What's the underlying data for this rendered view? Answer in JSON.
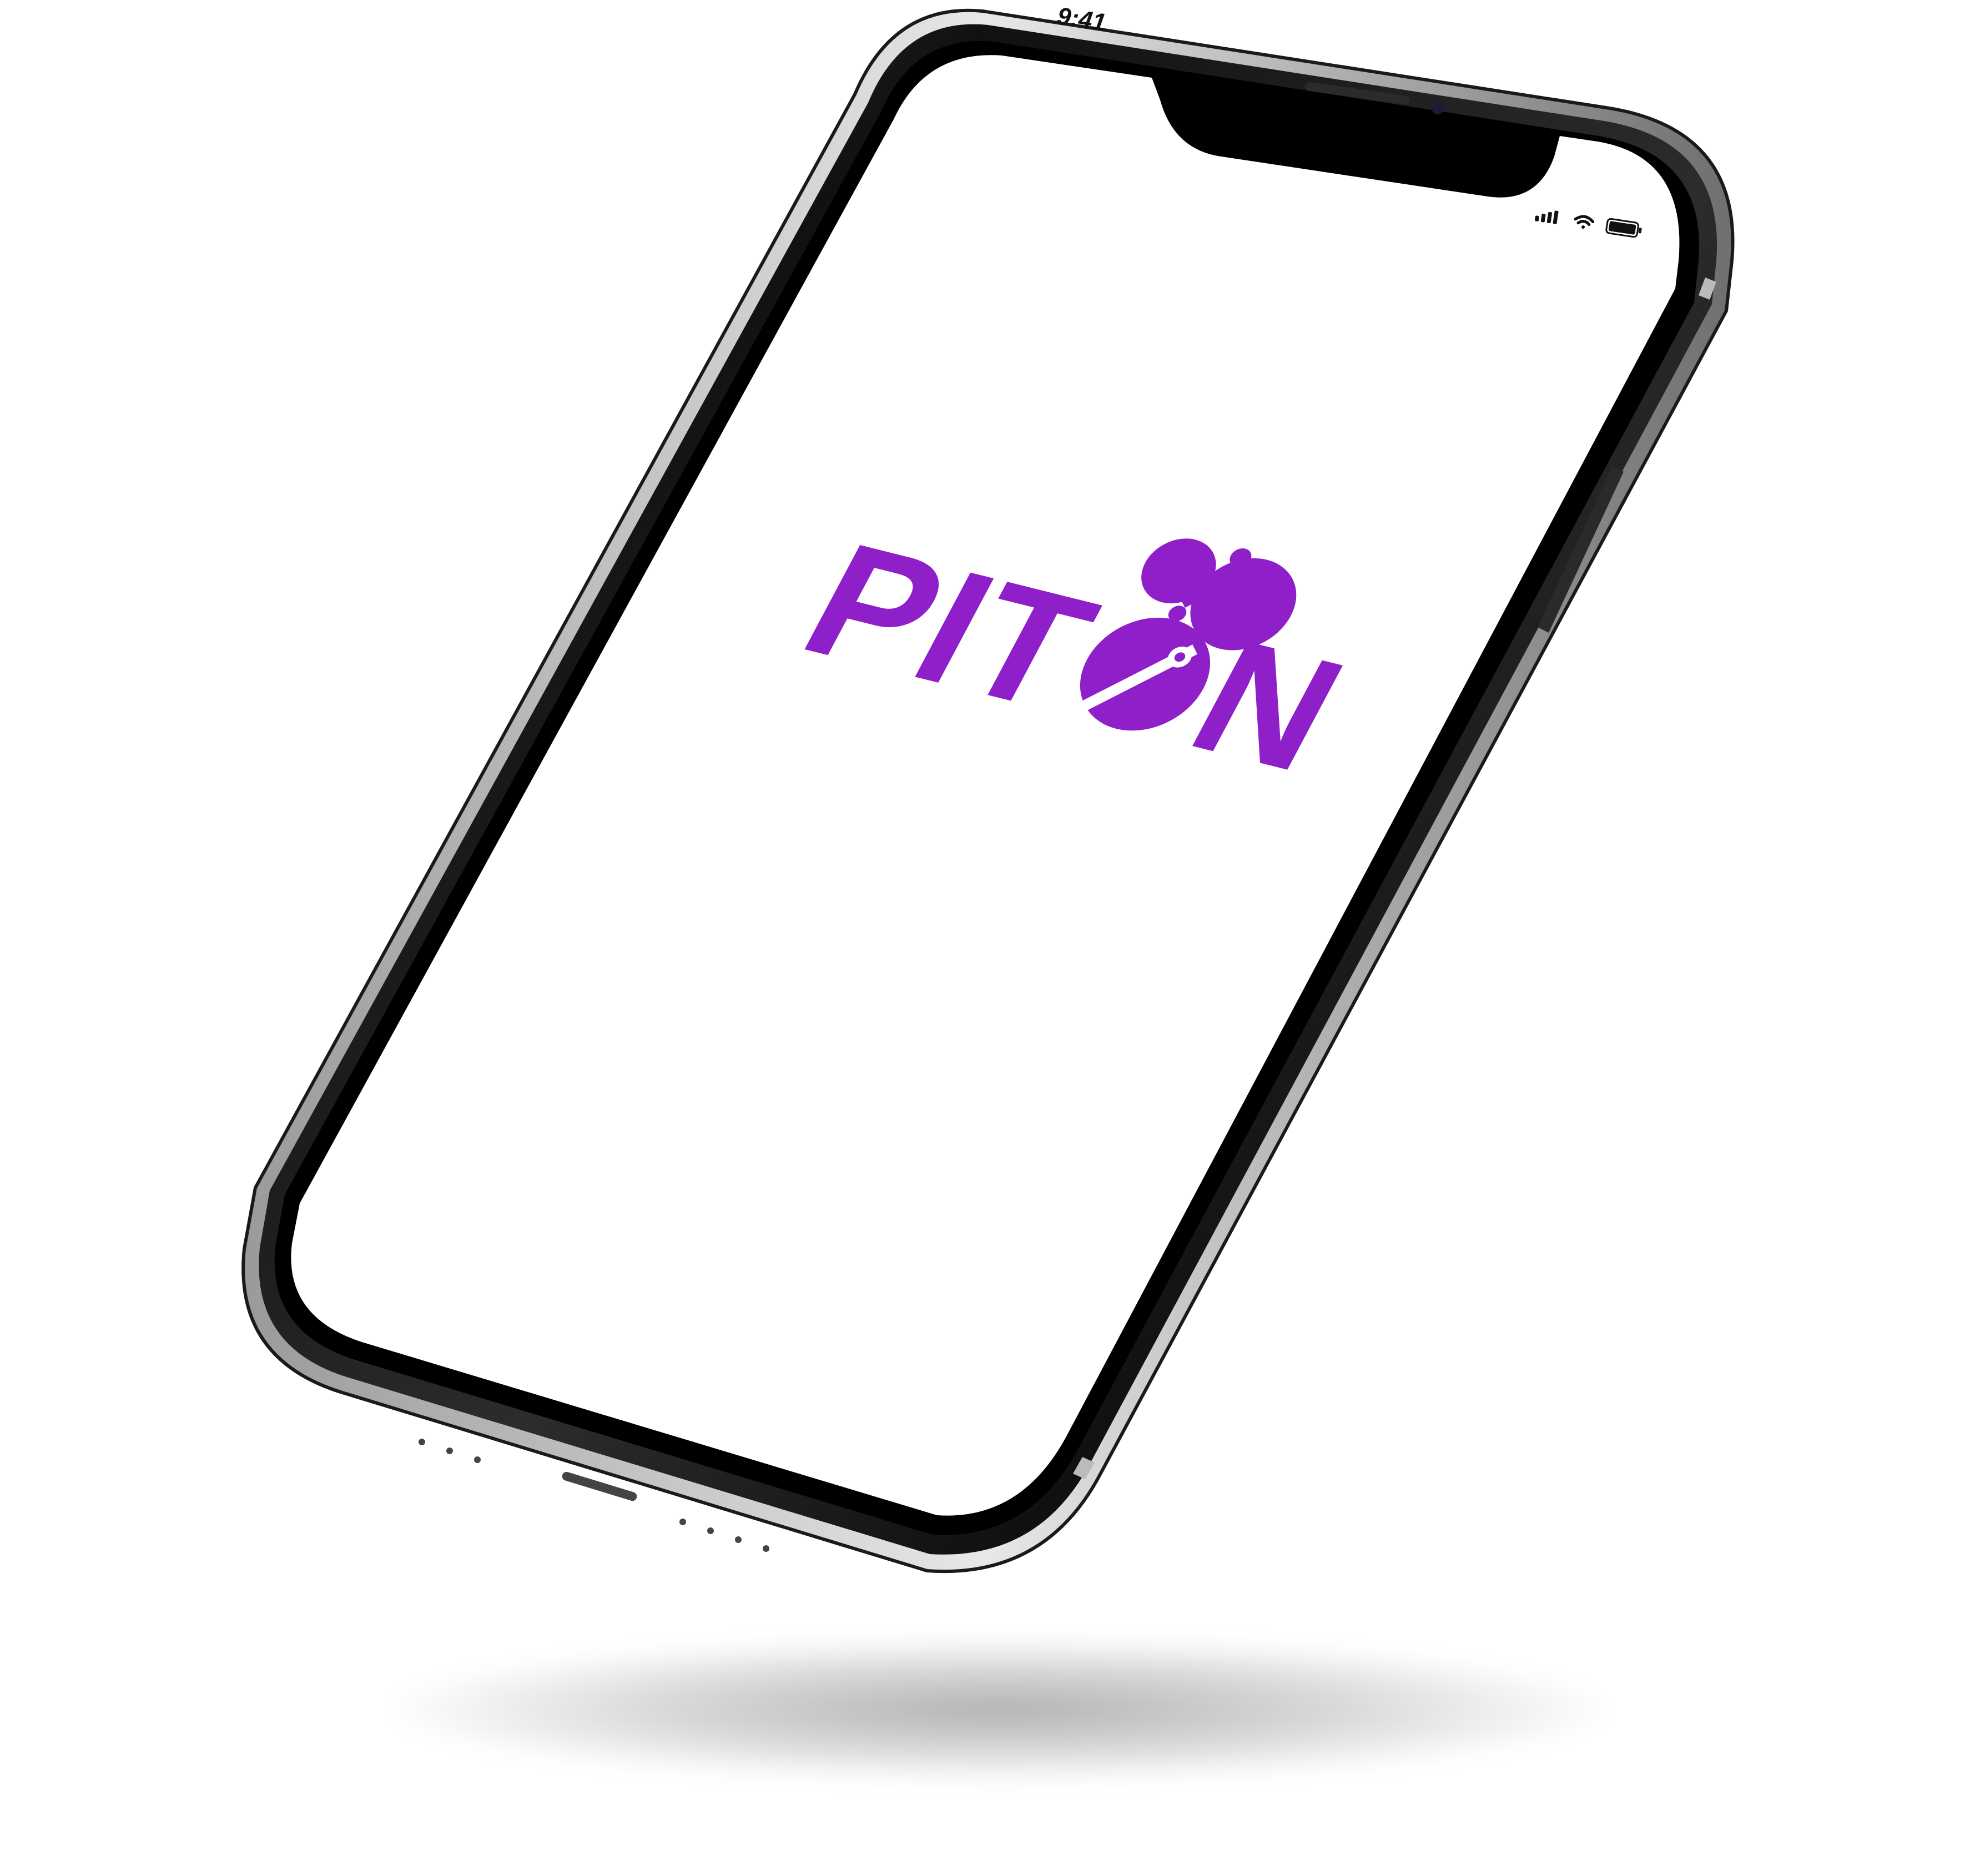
{
  "status_bar": {
    "time": "9:41",
    "icons": [
      "cellular-signal-icon",
      "wifi-icon",
      "battery-icon"
    ]
  },
  "app": {
    "brand": "PITON",
    "brand_letters": [
      "P",
      "I",
      "T",
      "N"
    ],
    "logo_icon": "piton-o-molecule-icon",
    "brand_color": "#8e1fc9",
    "screen_background": "#ffffff"
  },
  "device": {
    "model_icon": "iphone-x-frame",
    "frame_color": "#0d0d0d"
  }
}
